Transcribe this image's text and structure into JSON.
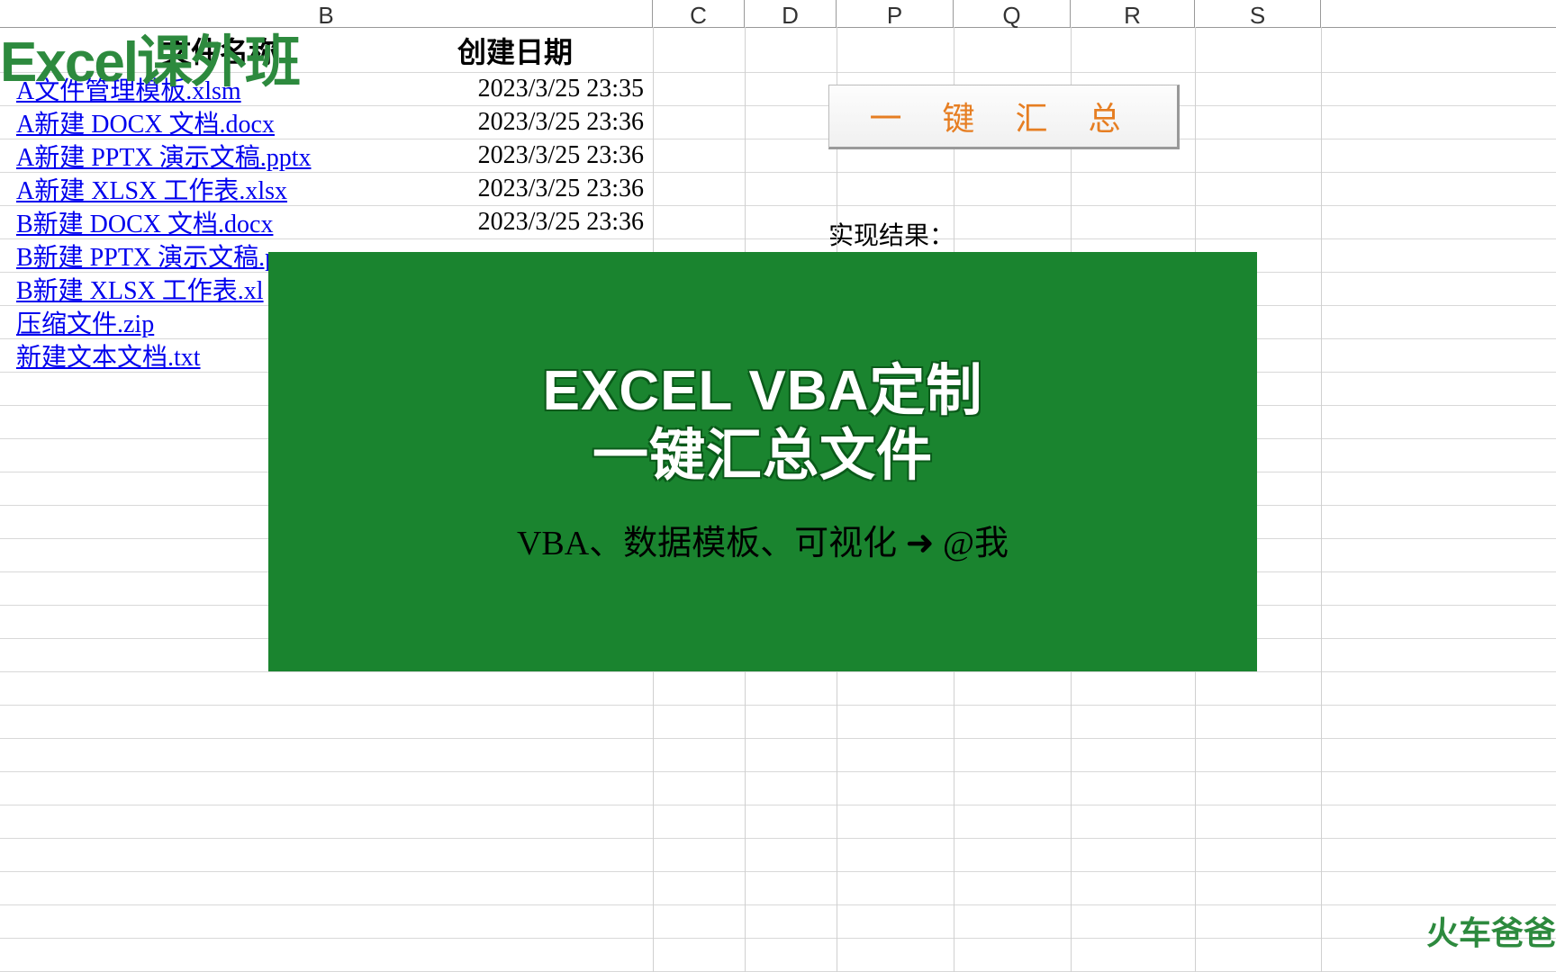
{
  "watermark": "Excel课外班",
  "columns": [
    "B",
    "C",
    "D",
    "P",
    "Q",
    "R",
    "S"
  ],
  "table": {
    "header_a": "文件名称",
    "header_b": "创建日期",
    "rows": [
      {
        "name": "A文件管理模板.xlsm",
        "date": "2023/3/25 23:35"
      },
      {
        "name": "A新建 DOCX 文档.docx",
        "date": "2023/3/25 23:36"
      },
      {
        "name": "A新建 PPTX 演示文稿.pptx",
        "date": "2023/3/25 23:36"
      },
      {
        "name": "A新建 XLSX 工作表.xlsx",
        "date": "2023/3/25 23:36"
      },
      {
        "name": "B新建 DOCX 文档.docx",
        "date": "2023/3/25 23:36"
      },
      {
        "name": "B新建 PPTX 演示文稿.p",
        "date": ""
      },
      {
        "name": "B新建 XLSX 工作表.xl",
        "date": ""
      },
      {
        "name": "压缩文件.zip",
        "date": ""
      },
      {
        "name": "新建文本文档.txt",
        "date": ""
      }
    ]
  },
  "button_label": "一 键 汇 总",
  "result_label": "实现结果：",
  "promo": {
    "line1": "EXCEL VBA定制",
    "line2": "一键汇总文件",
    "sub": "VBA、数据模板、可视化 ➜ @我"
  },
  "corner": "火车爸爸"
}
